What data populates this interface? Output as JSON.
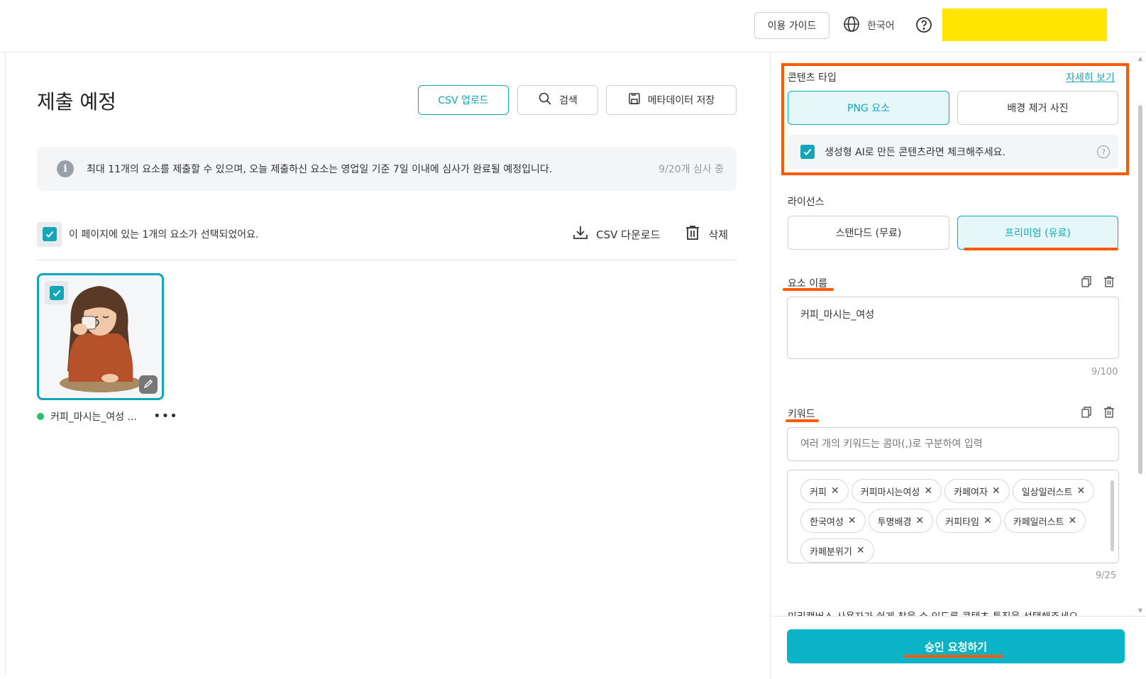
{
  "header": {
    "guide_label": "이용 가이드",
    "language_label": "한국어"
  },
  "main": {
    "title": "제출 예정",
    "csv_upload_label": "CSV 업로드",
    "search_label": "검색",
    "save_metadata_label": "메타데이터 저장",
    "notice_text": "최대 11개의 요소를 제출할 수 있으며, 오늘 제출하신 요소는 영업일 기준 7일 이내에 심사가 완료될 예정입니다.",
    "review_count": "9/20개 심사 중",
    "selection_text": "이 페이지에 있는 1개의 요소가 선택되었어요.",
    "csv_download_label": "CSV 다운로드",
    "delete_label": "삭제",
    "item": {
      "name": "커피_마시는_여성 ...",
      "more": "•••"
    }
  },
  "panel": {
    "content_type_label": "콘텐츠 타입",
    "details_link": "자세히 보기",
    "content_types": [
      "PNG 요소",
      "배경 제거 사진"
    ],
    "ai_check_text": "생성형 AI로 만든 콘텐츠라면 체크해주세요.",
    "license_label": "라이선스",
    "licenses": [
      "스탠다드 (무료)",
      "프리미엄 (유료)"
    ],
    "name_label": "요소 이름",
    "name_value": "커피_마시는_여성",
    "name_counter": "9/100",
    "keyword_label": "키워드",
    "keyword_placeholder": "여러 개의 키워드는 콤마(,)로 구분하여 입력",
    "keywords": [
      "커피",
      "커피마시는여성",
      "카페여자",
      "일상일러스트",
      "한국여성",
      "투명배경",
      "커피타임",
      "카페일러스트",
      "카페분위기"
    ],
    "keyword_counter": "9/25",
    "cut_text": "미리캔버스 사용자가 쉽게 찾을 수 있도록 콘텐츠 특징을 선택해주세요.",
    "submit_label": "승인 요청하기"
  },
  "colors": {
    "accent": "#14a6b8",
    "submit": "#0bb3c6",
    "highlight": "#ff5a00",
    "redaction": "#ffe500"
  }
}
